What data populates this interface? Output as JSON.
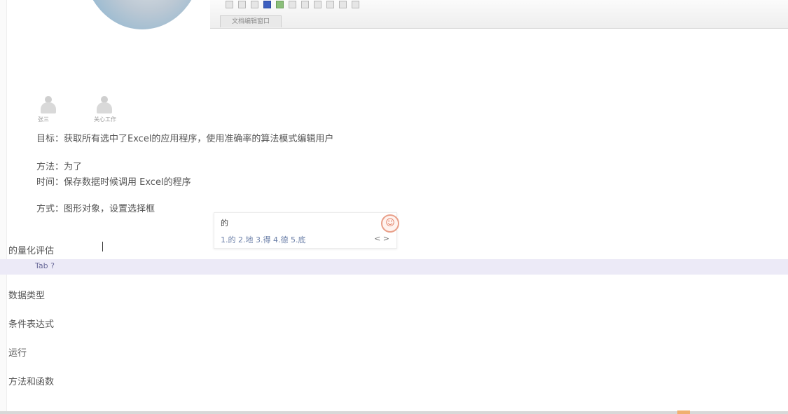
{
  "toolbar": {
    "tab_label": "文档编辑窗口"
  },
  "profiles": [
    {
      "caption": "张三"
    },
    {
      "caption": "关心工作"
    }
  ],
  "document": {
    "line1": "目标：获取所有选中了Excel的应用程序，使用准确率的算法模式编辑用户",
    "line2": "方法：为了",
    "line3": "时间：保存数据时候调用 Excel的程序",
    "line4": "方式：图形对象，设置选择框",
    "line5": "的量化评估",
    "highlight": "Tab ?",
    "items": [
      "数据类型",
      "条件表达式",
      "运行",
      "方法和函数"
    ]
  },
  "ime": {
    "input": "的",
    "candidates": "1.的  2.地  3.得  4.德  5.底",
    "more": "< >"
  }
}
